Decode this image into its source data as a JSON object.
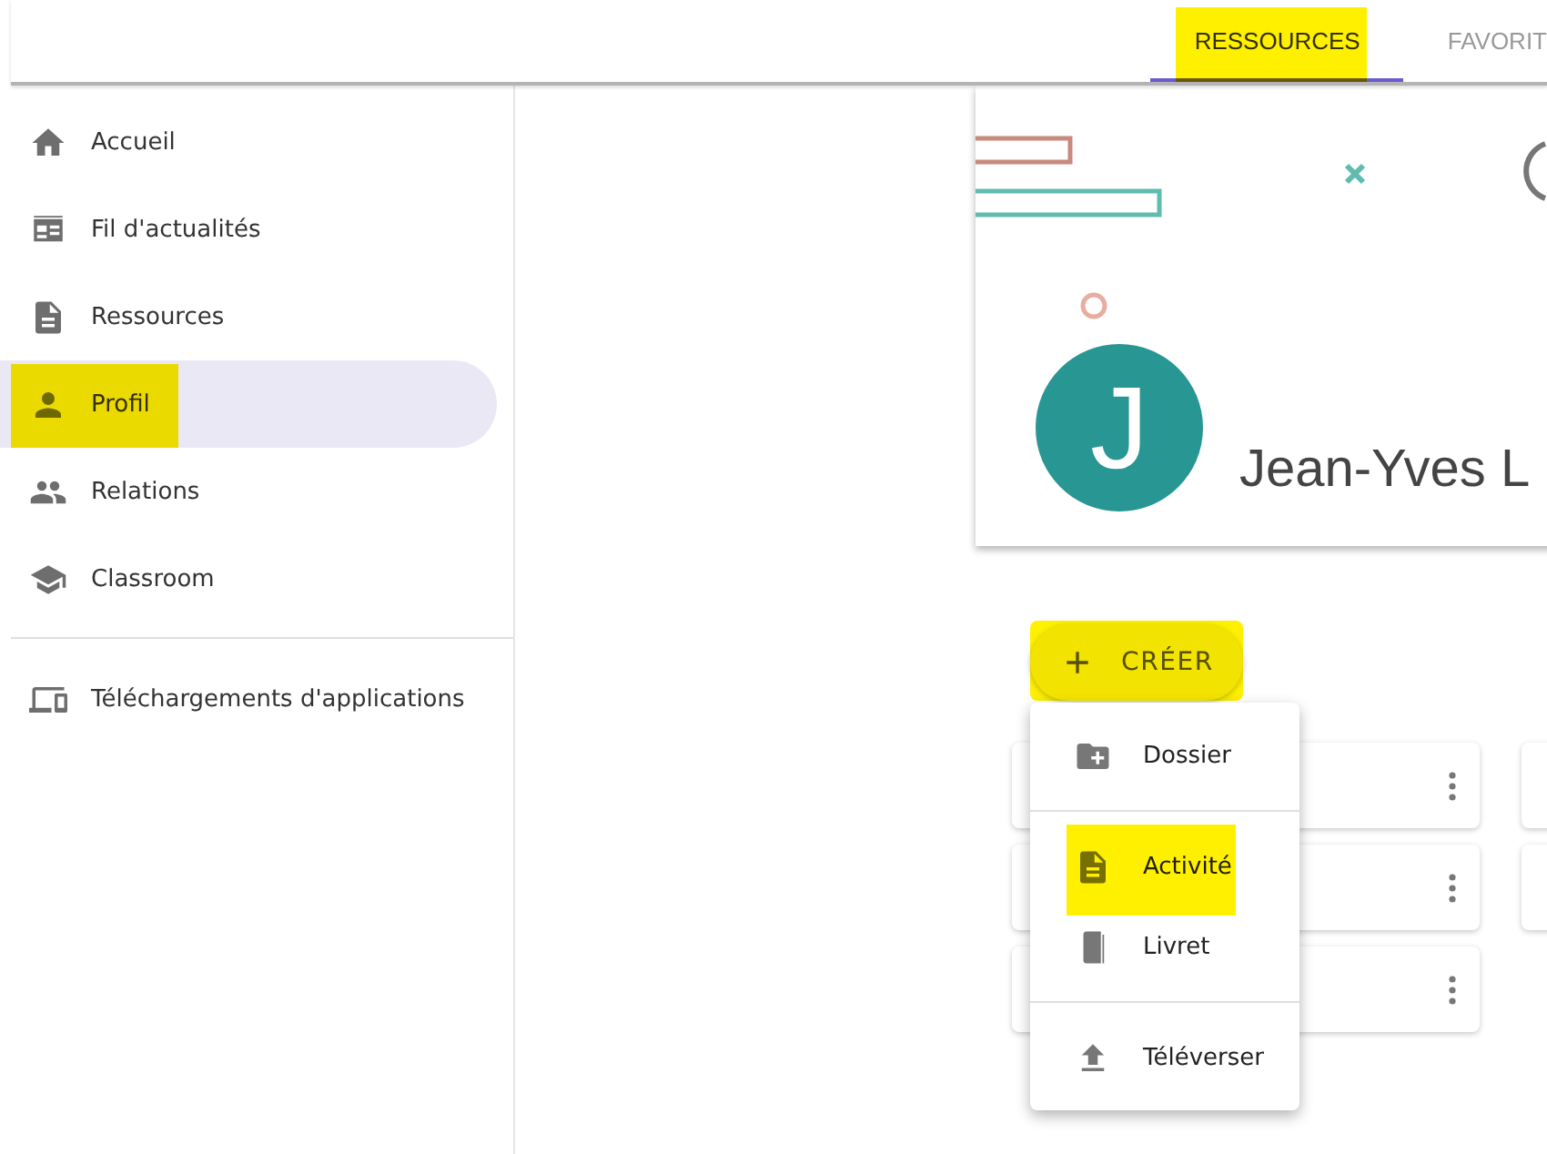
{
  "top_tabs": [
    {
      "label": "RESSOURCES",
      "selected": true,
      "highlighted": true
    },
    {
      "label": "FAVORIT",
      "selected": false,
      "highlighted": false
    }
  ],
  "sidebar": {
    "items": [
      {
        "label": "Accueil",
        "selected": false,
        "highlighted": false
      },
      {
        "label": "Fil d'actualités",
        "selected": false,
        "highlighted": false
      },
      {
        "label": "Ressources",
        "selected": false,
        "highlighted": false
      },
      {
        "label": "Profil",
        "selected": true,
        "highlighted": true
      },
      {
        "label": "Relations",
        "selected": false,
        "highlighted": false
      },
      {
        "label": "Classroom",
        "selected": false,
        "highlighted": false
      }
    ],
    "footer_items": [
      {
        "label": "Téléchargements d'applications",
        "selected": false,
        "highlighted": false
      }
    ]
  },
  "profile": {
    "initial": "J",
    "name": "Jean-Yves L"
  },
  "create_button": {
    "label": "CRÉER",
    "highlighted": true
  },
  "create_menu": [
    {
      "label": "Dossier",
      "highlighted": false,
      "divider_after": true
    },
    {
      "label": "Activité",
      "highlighted": true,
      "divider_after": false
    },
    {
      "label": "Livret",
      "highlighted": false,
      "divider_after": true
    },
    {
      "label": "Téléverser",
      "highlighted": false,
      "divider_after": false
    }
  ]
}
